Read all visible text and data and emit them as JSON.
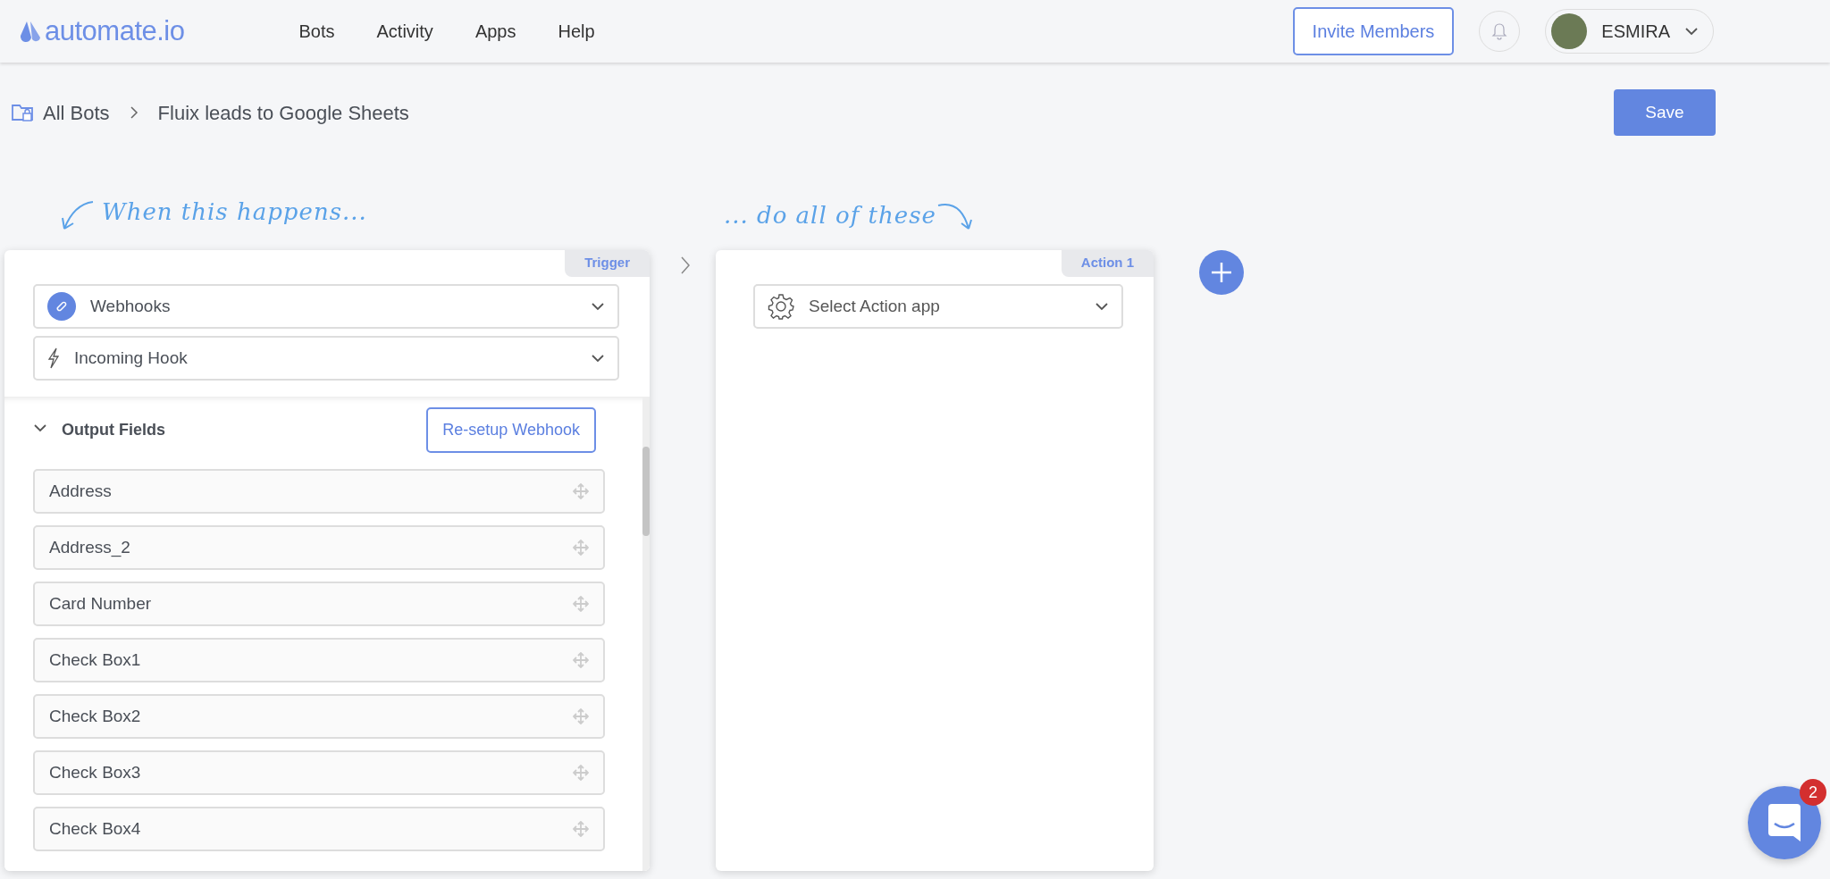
{
  "logo": {
    "text": "automate.io"
  },
  "nav": [
    {
      "label": "Bots"
    },
    {
      "label": "Activity"
    },
    {
      "label": "Apps"
    },
    {
      "label": "Help"
    }
  ],
  "invite_button": "Invite Members",
  "user": {
    "name": "ESMIRA"
  },
  "breadcrumb": [
    "All Bots",
    "Fluix leads to Google Sheets"
  ],
  "save_button": "Save",
  "trigger_caption": "When this happens...",
  "action_caption": "... do all of these",
  "trigger": {
    "tab": "Trigger",
    "app": "Webhooks",
    "event": "Incoming Hook",
    "output": {
      "title": "Output Fields",
      "expanded": true,
      "button": "Re-setup Webhook",
      "fields": [
        "Address",
        "Address_2",
        "Card Number",
        "Check Box1",
        "Check Box2",
        "Check Box3",
        "Check Box4"
      ]
    }
  },
  "actions": [
    {
      "tab": "Action 1",
      "placeholder": "Select Action app"
    }
  ],
  "chat": {
    "badge": "2"
  }
}
